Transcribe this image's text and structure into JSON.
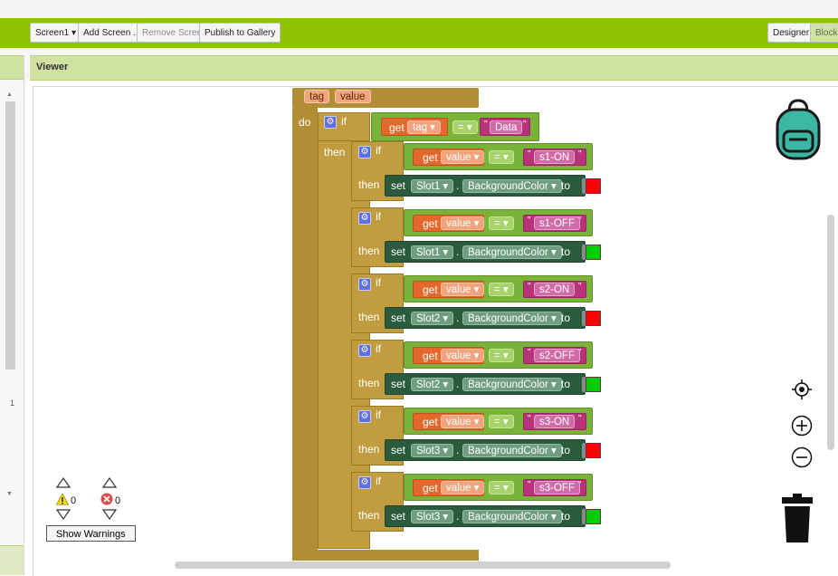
{
  "toolbar": {
    "screen_selector": "Screen1 ▾",
    "add_screen": "Add Screen ...",
    "remove_screen": "Remove Screen",
    "publish": "Publish to Gallery",
    "designer": "Designer",
    "blocks": "Blocks"
  },
  "viewer": {
    "title": "Viewer"
  },
  "left_panel": {
    "line_number": "1"
  },
  "event_block": {
    "params": [
      "tag",
      "value"
    ],
    "do_label": "do"
  },
  "keywords": {
    "if": "if",
    "then": "then",
    "get": "get",
    "set": "set",
    "to": "to",
    "dot": "."
  },
  "outer_if": {
    "get_var": "tag ▾",
    "operator": "= ▾",
    "string": "Data"
  },
  "rules": [
    {
      "value_var": "value ▾",
      "operator": "= ▾",
      "string": "s1-ON",
      "component": "Slot1 ▾",
      "property": "BackgroundColor ▾",
      "color": "#ff0000"
    },
    {
      "value_var": "value ▾",
      "operator": "= ▾",
      "string": "s1-OFF",
      "component": "Slot1 ▾",
      "property": "BackgroundColor ▾",
      "color": "#00cc00"
    },
    {
      "value_var": "value ▾",
      "operator": "= ▾",
      "string": "s2-ON",
      "component": "Slot2 ▾",
      "property": "BackgroundColor ▾",
      "color": "#ff0000"
    },
    {
      "value_var": "value ▾",
      "operator": "= ▾",
      "string": "s2-OFF",
      "component": "Slot2 ▾",
      "property": "BackgroundColor ▾",
      "color": "#00cc00"
    },
    {
      "value_var": "value ▾",
      "operator": "= ▾",
      "string": "s3-ON",
      "component": "Slot3 ▾",
      "property": "BackgroundColor ▾",
      "color": "#ff0000"
    },
    {
      "value_var": "value ▾",
      "operator": "= ▾",
      "string": "s3-OFF",
      "component": "Slot3 ▾",
      "property": "BackgroundColor ▾",
      "color": "#00cc00"
    }
  ],
  "warnings": {
    "warning_count": "0",
    "error_count": "0",
    "show_warnings": "Show Warnings"
  },
  "colors": {
    "toolbar_green": "#8fc202",
    "event_block": "#b18e35",
    "control_block": "#c29d3f",
    "logic_block": "#7ab33a",
    "setter_block": "#295b3c",
    "getter_block": "#e4682b",
    "text_block": "#b8337a"
  },
  "icons": [
    "backpack-icon",
    "locate-icon",
    "zoom-in-icon",
    "zoom-out-icon",
    "trash-icon",
    "warning-icon",
    "error-icon"
  ]
}
